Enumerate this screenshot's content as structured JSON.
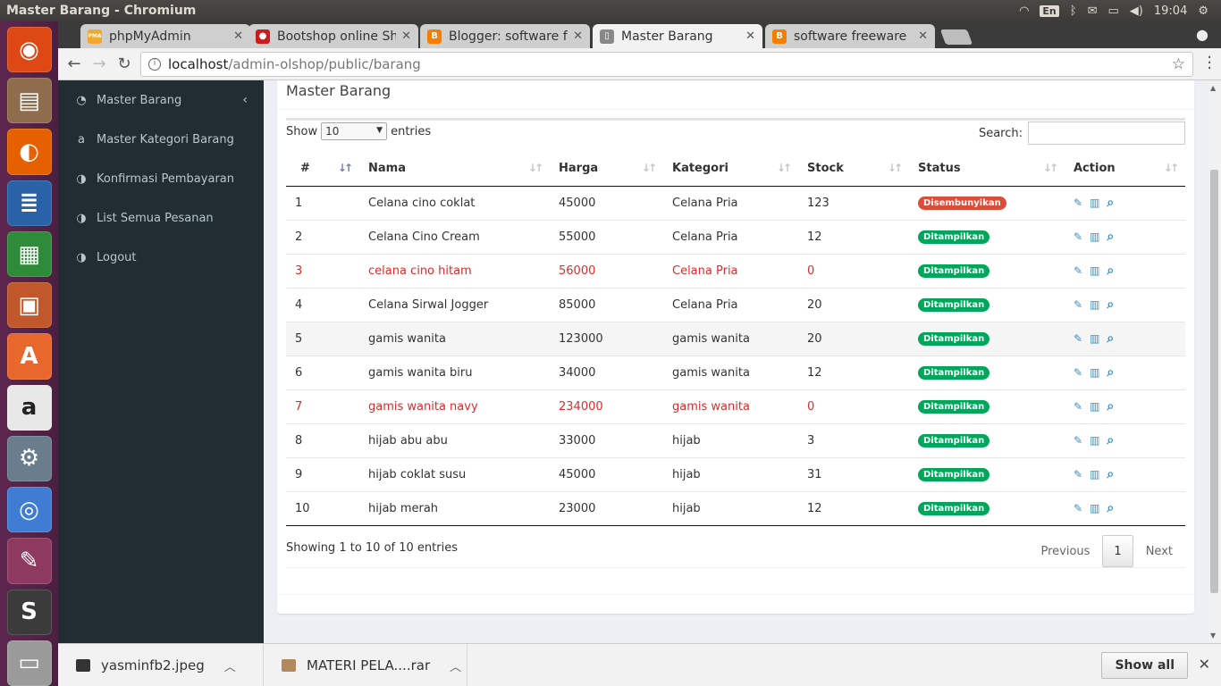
{
  "window": {
    "title": "Master Barang - Chromium",
    "time": "19:04",
    "lang": "En"
  },
  "launcher": [
    {
      "name": "ubuntu-dash-icon",
      "glyph": "◉",
      "color": "#dd4814"
    },
    {
      "name": "files-icon",
      "glyph": "▤",
      "color": "#8e6c4c"
    },
    {
      "name": "firefox-icon",
      "glyph": "◐",
      "color": "#e66000"
    },
    {
      "name": "writer-icon",
      "glyph": "≣",
      "color": "#2a62a8"
    },
    {
      "name": "calc-icon",
      "glyph": "▦",
      "color": "#2e8b3a"
    },
    {
      "name": "impress-icon",
      "glyph": "▣",
      "color": "#c0582b"
    },
    {
      "name": "software-center-icon",
      "glyph": "A",
      "color": "#e8672d"
    },
    {
      "name": "amazon-icon",
      "glyph": "a",
      "color": "#e8e8e8"
    },
    {
      "name": "settings-icon",
      "glyph": "⚙",
      "color": "#6a7d8c"
    },
    {
      "name": "chromium-icon",
      "glyph": "◎",
      "color": "#3f7dd4"
    },
    {
      "name": "app-icon",
      "glyph": "✎",
      "color": "#8e3a5e"
    },
    {
      "name": "sublime-icon",
      "glyph": "S",
      "color": "#3b3b3b"
    },
    {
      "name": "scanner-icon",
      "glyph": "▭",
      "color": "#9a9a9a"
    }
  ],
  "tabs": [
    {
      "label": "phpMyAdmin",
      "icon": "PMA",
      "color": "#f0a830"
    },
    {
      "label": "Bootshop online Sh",
      "icon": "●",
      "color": "#c81e1e"
    },
    {
      "label": "Blogger: software f",
      "icon": "B",
      "color": "#f57d00"
    },
    {
      "label": "Master Barang",
      "icon": "▯",
      "color": "#888888"
    },
    {
      "label": "software freeware",
      "icon": "B",
      "color": "#f57d00"
    }
  ],
  "address": {
    "host": "localhost",
    "path": "/admin-olshop/public/barang"
  },
  "sidebar": [
    {
      "label": "Master Barang",
      "icon": "◔",
      "name": "sidebar-item-master-barang"
    },
    {
      "label": "Master Kategori Barang",
      "icon": "a",
      "name": "sidebar-item-master-kategori"
    },
    {
      "label": "Konfirmasi Pembayaran",
      "icon": "◑",
      "name": "sidebar-item-konfirmasi"
    },
    {
      "label": "List Semua Pesanan",
      "icon": "◑",
      "name": "sidebar-item-list-pesanan"
    },
    {
      "label": "Logout",
      "icon": "◑",
      "name": "sidebar-item-logout"
    }
  ],
  "main": {
    "title": "Master Barang",
    "show_label": "Show",
    "entries_label": "entries",
    "length_value": "10",
    "search_label": "Search:",
    "columns": [
      "#",
      "Nama",
      "Harga",
      "Kategori",
      "Stock",
      "Status",
      "Action"
    ],
    "rows": [
      {
        "no": "1",
        "nama": "Celana cino coklat",
        "harga": "45000",
        "kategori": "Celana Pria",
        "stock": "123",
        "status": "Disembunyikan",
        "red": false
      },
      {
        "no": "2",
        "nama": "Celana Cino Cream",
        "harga": "55000",
        "kategori": "Celana Pria",
        "stock": "12",
        "status": "Ditampilkan",
        "red": false
      },
      {
        "no": "3",
        "nama": "celana cino hitam",
        "harga": "56000",
        "kategori": "Celana Pria",
        "stock": "0",
        "status": "Ditampilkan",
        "red": true
      },
      {
        "no": "4",
        "nama": "Celana Sirwal Jogger",
        "harga": "85000",
        "kategori": "Celana Pria",
        "stock": "20",
        "status": "Ditampilkan",
        "red": false
      },
      {
        "no": "5",
        "nama": "gamis wanita",
        "harga": "123000",
        "kategori": "gamis wanita",
        "stock": "20",
        "status": "Ditampilkan",
        "red": false
      },
      {
        "no": "6",
        "nama": "gamis wanita biru",
        "harga": "34000",
        "kategori": "gamis wanita",
        "stock": "12",
        "status": "Ditampilkan",
        "red": false
      },
      {
        "no": "7",
        "nama": "gamis wanita navy",
        "harga": "234000",
        "kategori": "gamis wanita",
        "stock": "0",
        "status": "Ditampilkan",
        "red": true
      },
      {
        "no": "8",
        "nama": "hijab abu abu",
        "harga": "33000",
        "kategori": "hijab",
        "stock": "3",
        "status": "Ditampilkan",
        "red": false
      },
      {
        "no": "9",
        "nama": "hijab coklat susu",
        "harga": "45000",
        "kategori": "hijab",
        "stock": "31",
        "status": "Ditampilkan",
        "red": false
      },
      {
        "no": "10",
        "nama": "hijab merah",
        "harga": "23000",
        "kategori": "hijab",
        "stock": "12",
        "status": "Ditampilkan",
        "red": false
      }
    ],
    "info": "Showing 1 to 10 of 10 entries",
    "pager": {
      "prev": "Previous",
      "current": "1",
      "next": "Next"
    }
  },
  "downloads": [
    {
      "label": "yasminfb2.jpeg",
      "color": "#333333"
    },
    {
      "label": "MATERI PELA....rar",
      "color": "#b08a5a"
    }
  ],
  "show_all": "Show all"
}
